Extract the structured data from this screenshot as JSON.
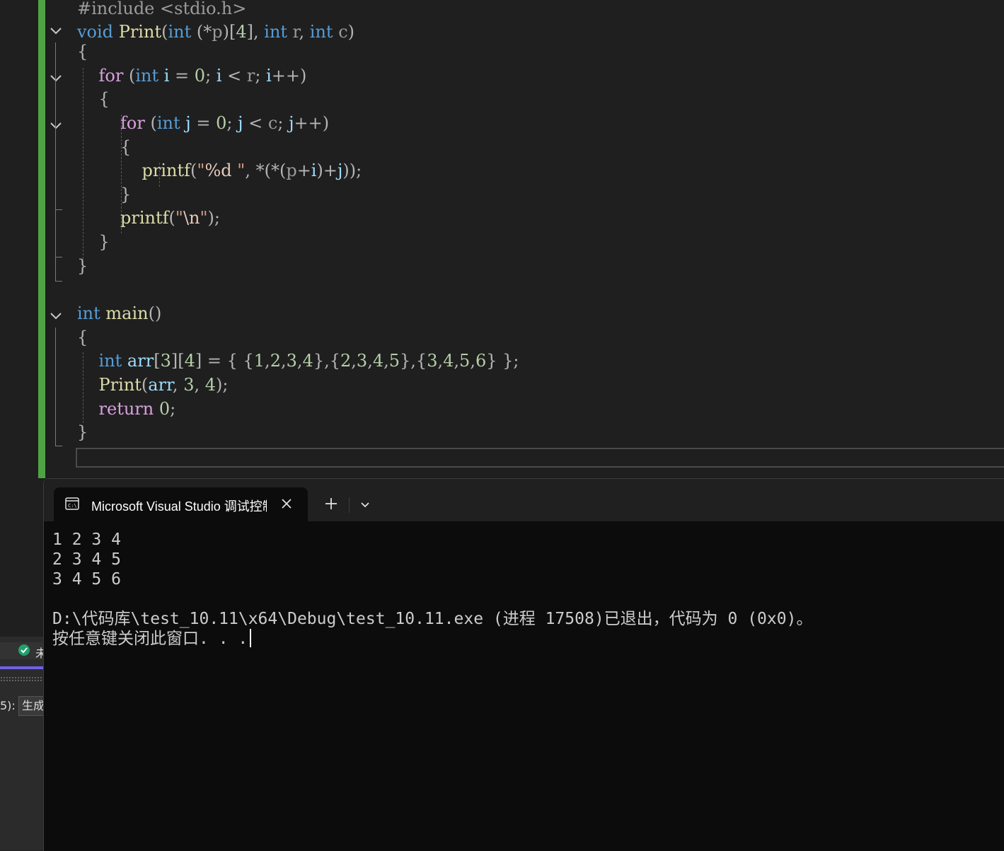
{
  "editor": {
    "lines": [
      [
        {
          "t": "#include ",
          "c": "pp"
        },
        {
          "t": "<stdio.h>",
          "c": "pp"
        }
      ],
      [
        {
          "t": "void ",
          "c": "kw"
        },
        {
          "t": "Print",
          "c": "fn"
        },
        {
          "t": "(",
          "c": "pun"
        },
        {
          "t": "int ",
          "c": "kw"
        },
        {
          "t": "(*",
          "c": "pun"
        },
        {
          "t": "p",
          "c": "prm"
        },
        {
          "t": ")[",
          "c": "pun"
        },
        {
          "t": "4",
          "c": "num"
        },
        {
          "t": "], ",
          "c": "pun"
        },
        {
          "t": "int ",
          "c": "kw"
        },
        {
          "t": "r",
          "c": "prm"
        },
        {
          "t": ", ",
          "c": "pun"
        },
        {
          "t": "int ",
          "c": "kw"
        },
        {
          "t": "c",
          "c": "prm"
        },
        {
          "t": ")",
          "c": "pun"
        }
      ],
      [
        {
          "t": "{",
          "c": "pun"
        }
      ],
      [
        {
          "t": "    "
        },
        {
          "t": "for ",
          "c": "ctl"
        },
        {
          "t": "(",
          "c": "pun"
        },
        {
          "t": "int ",
          "c": "kw"
        },
        {
          "t": "i ",
          "c": "var"
        },
        {
          "t": "= ",
          "c": "pun"
        },
        {
          "t": "0",
          "c": "num"
        },
        {
          "t": "; ",
          "c": "pun"
        },
        {
          "t": "i ",
          "c": "var"
        },
        {
          "t": "< ",
          "c": "pun"
        },
        {
          "t": "r",
          "c": "prm"
        },
        {
          "t": "; ",
          "c": "pun"
        },
        {
          "t": "i",
          "c": "var"
        },
        {
          "t": "++)",
          "c": "pun"
        }
      ],
      [
        {
          "t": "    "
        },
        {
          "t": "{",
          "c": "pun"
        }
      ],
      [
        {
          "t": "        "
        },
        {
          "t": "for ",
          "c": "ctl"
        },
        {
          "t": "(",
          "c": "pun"
        },
        {
          "t": "int ",
          "c": "kw"
        },
        {
          "t": "j ",
          "c": "var"
        },
        {
          "t": "= ",
          "c": "pun"
        },
        {
          "t": "0",
          "c": "num"
        },
        {
          "t": "; ",
          "c": "pun"
        },
        {
          "t": "j ",
          "c": "var"
        },
        {
          "t": "< ",
          "c": "pun"
        },
        {
          "t": "c",
          "c": "prm"
        },
        {
          "t": "; ",
          "c": "pun"
        },
        {
          "t": "j",
          "c": "var"
        },
        {
          "t": "++)",
          "c": "pun"
        }
      ],
      [
        {
          "t": "        "
        },
        {
          "t": "{",
          "c": "pun"
        }
      ],
      [
        {
          "t": "            "
        },
        {
          "t": "printf",
          "c": "fn"
        },
        {
          "t": "(",
          "c": "pun"
        },
        {
          "t": "\"",
          "c": "str"
        },
        {
          "t": "%d",
          "c": "esc"
        },
        {
          "t": " \"",
          "c": "str"
        },
        {
          "t": ", ",
          "c": "pun"
        },
        {
          "t": "*(*(",
          "c": "pun"
        },
        {
          "t": "p",
          "c": "prm"
        },
        {
          "t": "+",
          "c": "pun"
        },
        {
          "t": "i",
          "c": "var"
        },
        {
          "t": ")+",
          "c": "pun"
        },
        {
          "t": "j",
          "c": "var"
        },
        {
          "t": "));",
          "c": "pun"
        }
      ],
      [
        {
          "t": "        "
        },
        {
          "t": "}",
          "c": "pun"
        }
      ],
      [
        {
          "t": "        "
        },
        {
          "t": "printf",
          "c": "fn"
        },
        {
          "t": "(",
          "c": "pun"
        },
        {
          "t": "\"",
          "c": "str"
        },
        {
          "t": "\\n",
          "c": "esc"
        },
        {
          "t": "\"",
          "c": "str"
        },
        {
          "t": ");",
          "c": "pun"
        }
      ],
      [
        {
          "t": "    "
        },
        {
          "t": "}",
          "c": "pun"
        }
      ],
      [
        {
          "t": "}",
          "c": "pun"
        }
      ],
      [
        {
          "t": ""
        }
      ],
      [
        {
          "t": "int ",
          "c": "kw"
        },
        {
          "t": "main",
          "c": "fn"
        },
        {
          "t": "()",
          "c": "pun"
        }
      ],
      [
        {
          "t": "{",
          "c": "pun"
        }
      ],
      [
        {
          "t": "    "
        },
        {
          "t": "int ",
          "c": "kw"
        },
        {
          "t": "arr",
          "c": "var"
        },
        {
          "t": "[",
          "c": "pun"
        },
        {
          "t": "3",
          "c": "num"
        },
        {
          "t": "][",
          "c": "pun"
        },
        {
          "t": "4",
          "c": "num"
        },
        {
          "t": "] = { {",
          "c": "pun"
        },
        {
          "t": "1",
          "c": "num"
        },
        {
          "t": ",",
          "c": "pun"
        },
        {
          "t": "2",
          "c": "num"
        },
        {
          "t": ",",
          "c": "pun"
        },
        {
          "t": "3",
          "c": "num"
        },
        {
          "t": ",",
          "c": "pun"
        },
        {
          "t": "4",
          "c": "num"
        },
        {
          "t": "},{",
          "c": "pun"
        },
        {
          "t": "2",
          "c": "num"
        },
        {
          "t": ",",
          "c": "pun"
        },
        {
          "t": "3",
          "c": "num"
        },
        {
          "t": ",",
          "c": "pun"
        },
        {
          "t": "4",
          "c": "num"
        },
        {
          "t": ",",
          "c": "pun"
        },
        {
          "t": "5",
          "c": "num"
        },
        {
          "t": "},{",
          "c": "pun"
        },
        {
          "t": "3",
          "c": "num"
        },
        {
          "t": ",",
          "c": "pun"
        },
        {
          "t": "4",
          "c": "num"
        },
        {
          "t": ",",
          "c": "pun"
        },
        {
          "t": "5",
          "c": "num"
        },
        {
          "t": ",",
          "c": "pun"
        },
        {
          "t": "6",
          "c": "num"
        },
        {
          "t": "} };",
          "c": "pun"
        }
      ],
      [
        {
          "t": "    "
        },
        {
          "t": "Print",
          "c": "fn"
        },
        {
          "t": "(",
          "c": "pun"
        },
        {
          "t": "arr",
          "c": "var"
        },
        {
          "t": ", ",
          "c": "pun"
        },
        {
          "t": "3",
          "c": "num"
        },
        {
          "t": ", ",
          "c": "pun"
        },
        {
          "t": "4",
          "c": "num"
        },
        {
          "t": ");",
          "c": "pun"
        }
      ],
      [
        {
          "t": "    "
        },
        {
          "t": "return ",
          "c": "ctl"
        },
        {
          "t": "0",
          "c": "num"
        },
        {
          "t": ";",
          "c": "pun"
        }
      ],
      [
        {
          "t": "}",
          "c": "pun"
        }
      ]
    ]
  },
  "ide_panel": {
    "status_text": "未",
    "output_label": "5):",
    "output_select": "生成"
  },
  "terminal": {
    "tab_title": "Microsoft Visual Studio 调试控制台",
    "tab_icon": "console-icon",
    "output_lines": [
      "1 2 3 4",
      "2 3 4 5",
      "3 4 5 6",
      "",
      "D:\\代码库\\test_10.11\\x64\\Debug\\test_10.11.exe (进程 17508)已退出，代码为 0 (0x0)。",
      "按任意键关闭此窗口. . ."
    ]
  },
  "colors": {
    "change_bar": "#4ea443",
    "keyword": "#569cd6",
    "control": "#d8a0df",
    "function": "#dcdcaa",
    "number": "#b5cea8",
    "string": "#d69d85",
    "variable": "#9cdcfe"
  }
}
